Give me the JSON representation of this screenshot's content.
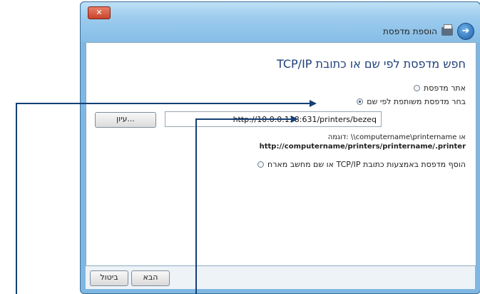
{
  "window": {
    "close_label": "✕",
    "back_icon": "arrow-left-icon",
    "nav_title": "הוספת מדפסת"
  },
  "content": {
    "heading": "חפש מדפסת לפי שם או כתובת TCP/IP",
    "options": [
      {
        "label": "אתר מדפסת",
        "checked": false
      },
      {
        "label": "בחר מדפסת משותפת לפי שם",
        "checked": true
      },
      {
        "label": "הוסף מדפסת באמצעות כתובת TCP/IP או שם מחשב מארח",
        "checked": false
      }
    ],
    "url_value": "http://10.0.0.138:631/printers/bezeq",
    "browse_label": "עיון...",
    "example_line1": "דוגמה: \\\\computername\\printername או",
    "example_line2": "http://computername/printers/printername/.printer"
  },
  "footer": {
    "next_label": "הבא",
    "cancel_label": "ביטול"
  },
  "colors": {
    "accent": "#163f76",
    "heading": "#1e3f7a",
    "frame": "#7fb7e2"
  }
}
